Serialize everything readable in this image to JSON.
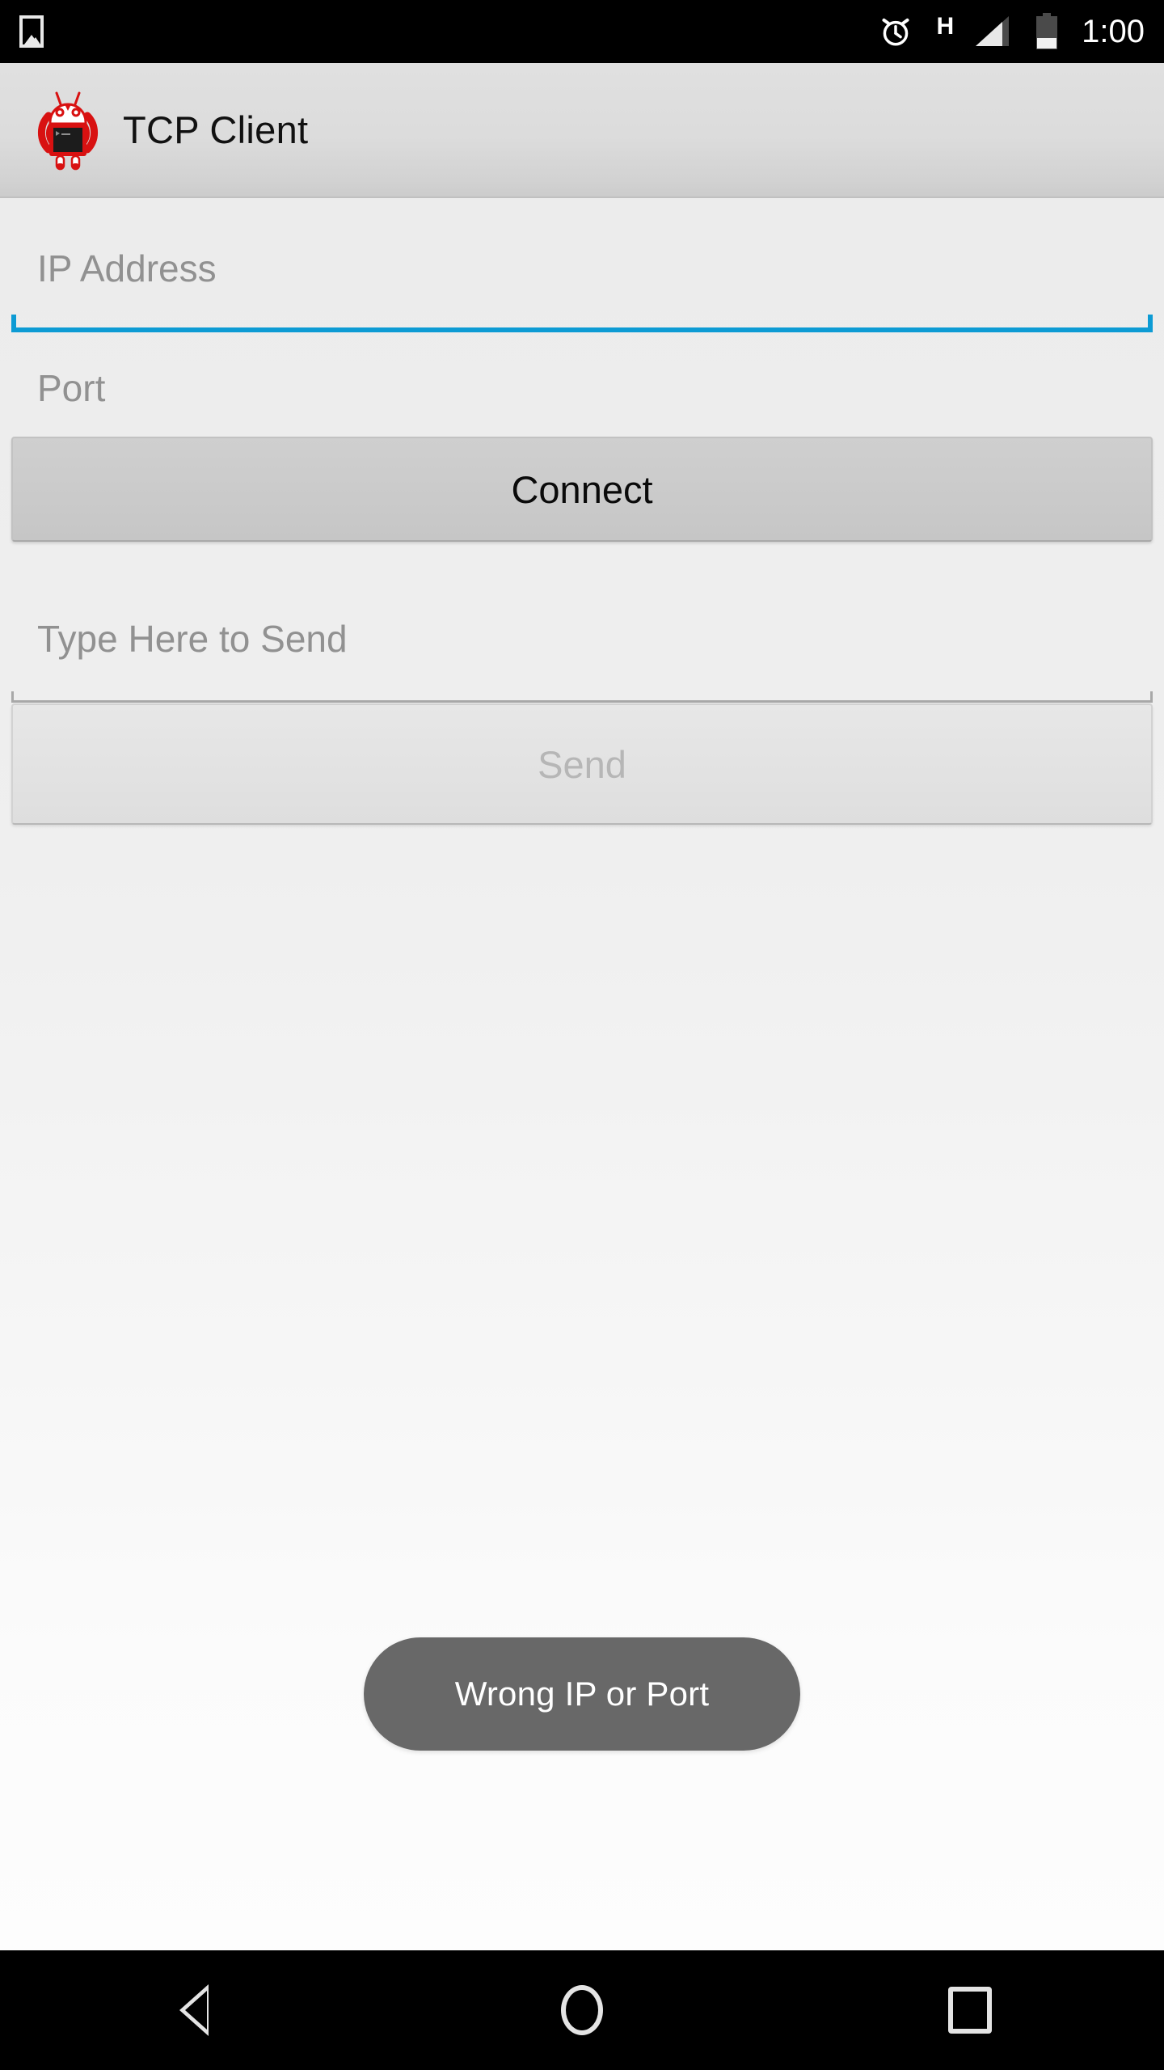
{
  "status_bar": {
    "left_icons": [
      {
        "name": "screenshot-icon",
        "label": "screenshot"
      }
    ],
    "alarm_icon": "alarm-clock-icon",
    "network_type": "H",
    "signal_icon": "signal-bars-icon",
    "battery_icon": "battery-low-icon",
    "clock": "1:00"
  },
  "action_bar": {
    "app_icon": "tcp-client-app-icon",
    "title": "TCP Client"
  },
  "form": {
    "ip_field": {
      "placeholder": "IP Address",
      "value": "",
      "focused": true
    },
    "port_field": {
      "placeholder": "Port",
      "value": "",
      "focused": false
    },
    "connect_button": {
      "label": "Connect",
      "enabled": true
    },
    "message_field": {
      "placeholder": "Type Here to Send",
      "value": "",
      "focused": false
    },
    "send_button": {
      "label": "Send",
      "enabled": false
    }
  },
  "toast": {
    "message": "Wrong IP or Port"
  },
  "nav_bar": {
    "back": "back-icon",
    "home": "home-icon",
    "recents": "recents-icon"
  },
  "colors": {
    "focus_underline": "#0d9bd4",
    "idle_underline": "#a8a8a8",
    "placeholder_text": "#919191",
    "toast_background": "#686868",
    "toast_text": "#ffffff",
    "connect_button_fill": "#cacaca",
    "send_button_fill": "#e2e2e2",
    "send_button_text": "#b6b6b6",
    "action_bar_fill": "#dcdcdc",
    "status_bar_fill": "#000000",
    "app_icon_accent": "#d81111"
  }
}
